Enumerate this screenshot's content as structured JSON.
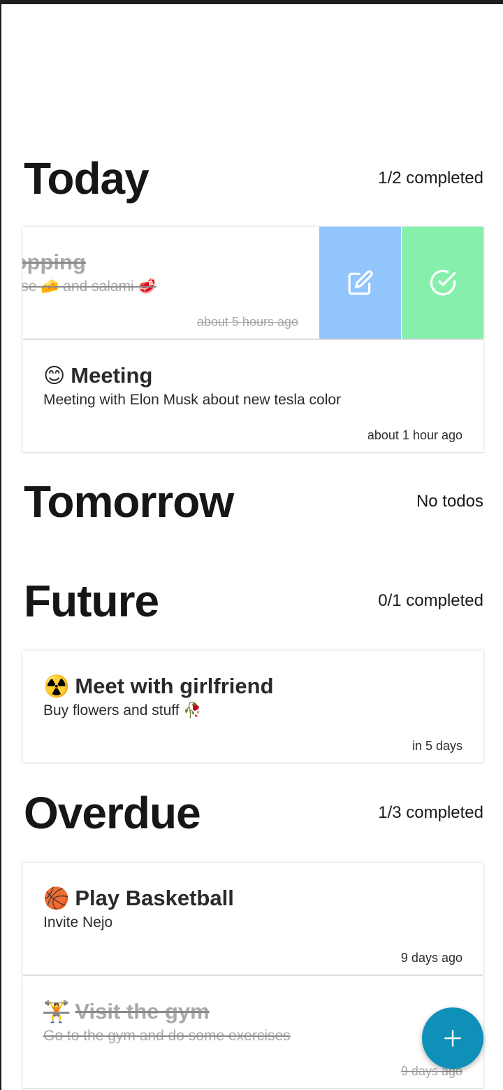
{
  "colors": {
    "edit_action": "#93c5fd",
    "complete_action": "#86efac",
    "fab": "#0e90b8",
    "completed_text": "#a9a9a9"
  },
  "sections": {
    "today": {
      "title": "Today",
      "status": "1/2 completed",
      "items": [
        {
          "title": "Shopping",
          "description": "Cheese 🧀 and salami 🥩",
          "time": "about 5 hours ago",
          "completed": true,
          "swiped": true,
          "actions": {
            "edit_icon": "edit-icon",
            "complete_icon": "check-circle-icon"
          }
        },
        {
          "emoji": "😊",
          "title": "Meeting",
          "description": "Meeting with Elon Musk about new tesla color",
          "time": "about 1 hour ago",
          "completed": false
        }
      ]
    },
    "tomorrow": {
      "title": "Tomorrow",
      "status": "No todos"
    },
    "future": {
      "title": "Future",
      "status": "0/1 completed",
      "items": [
        {
          "emoji": "☢️",
          "title": "Meet with girlfriend",
          "description": "Buy flowers and stuff 🥀",
          "time": "in 5 days",
          "completed": false
        }
      ]
    },
    "overdue": {
      "title": "Overdue",
      "status": "1/3 completed",
      "items": [
        {
          "emoji": "🏀",
          "title": "Play Basketball",
          "description": "Invite Nejo",
          "time": "9 days ago",
          "completed": false
        },
        {
          "emoji": "🏋️",
          "title": "Visit the gym",
          "description": "Go to the gym and do some exercises",
          "time": "9 days ago",
          "completed": true
        }
      ]
    }
  },
  "fab": {
    "icon": "plus-icon"
  }
}
